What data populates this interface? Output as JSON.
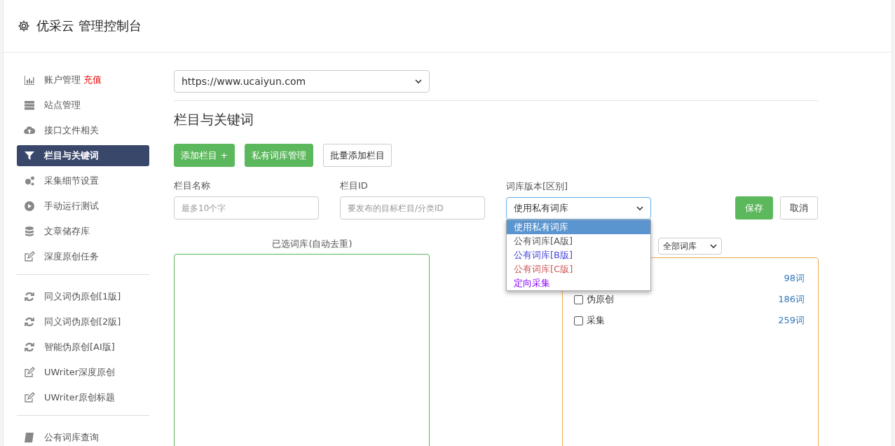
{
  "header": {
    "title": "优采云 管理控制台"
  },
  "sidebar": {
    "groups": [
      {
        "items": [
          {
            "label": "账户管理",
            "badge": "充值",
            "selected": false
          },
          {
            "label": "站点管理",
            "selected": false
          },
          {
            "label": "接口文件相关",
            "selected": false
          },
          {
            "label": "栏目与关键词",
            "selected": true
          },
          {
            "label": "采集细节设置",
            "selected": false
          },
          {
            "label": "手动运行测试",
            "selected": false
          },
          {
            "label": "文章储存库",
            "selected": false
          },
          {
            "label": "深度原创任务",
            "selected": false
          }
        ]
      },
      {
        "items": [
          {
            "label": "同义词伪原创[1版]",
            "selected": false
          },
          {
            "label": "同义词伪原创[2版]",
            "selected": false
          },
          {
            "label": "智能伪原创[AI版]",
            "selected": false
          },
          {
            "label": "UWriter深度原创",
            "selected": false
          },
          {
            "label": "UWriter原创标题",
            "selected": false
          }
        ]
      },
      {
        "items": [
          {
            "label": "公有词库查询",
            "selected": false
          }
        ]
      }
    ]
  },
  "site_select": {
    "value": "https://www.ucaiyun.com"
  },
  "heading": "栏目与关键词",
  "buttons": [
    {
      "label": "添加栏目 +",
      "kind": "green"
    },
    {
      "label": "私有词库管理",
      "kind": "green"
    },
    {
      "label": "批量添加栏目",
      "kind": "plain"
    }
  ],
  "form": {
    "name_label": "栏目名称",
    "name_placeholder": "最多10个字",
    "id_label": "栏目ID",
    "id_placeholder": "要发布的目标栏目/分类ID",
    "lib_label": "词库版本[区别]",
    "lib_value": "使用私有词库",
    "options": [
      {
        "label": "使用私有词库",
        "selected": true
      },
      {
        "label": "公有词库[A版]",
        "selected": false,
        "color": "#555555"
      },
      {
        "label": "公有词库[B版]",
        "selected": false,
        "color": "#4444dd"
      },
      {
        "label": "公有词库[C版]",
        "selected": false,
        "color": "#cc5555"
      },
      {
        "label": "定向采集",
        "selected": false,
        "color": "#8800ff"
      }
    ],
    "save": "保存",
    "cancel": "取消"
  },
  "selected_libs": {
    "label": "已选词库(自动去重)"
  },
  "library_filter": {
    "value": "全部词库"
  },
  "libraries": [
    {
      "count": "98词"
    },
    {
      "label": "伪原创",
      "count": "186词",
      "checked": false
    },
    {
      "label": "采集",
      "count": "259词",
      "checked": false
    }
  ]
}
